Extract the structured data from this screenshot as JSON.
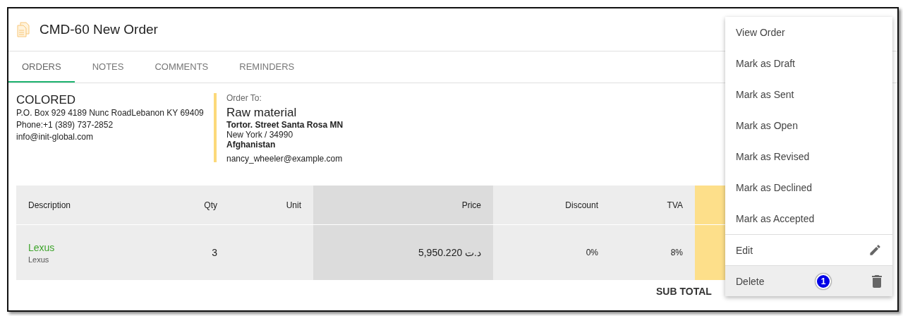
{
  "page": {
    "title": "CMD-60 New Order"
  },
  "tabs": [
    {
      "label": "ORDERS",
      "selected": true
    },
    {
      "label": "NOTES",
      "selected": false
    },
    {
      "label": "COMMENTS",
      "selected": false
    },
    {
      "label": "REMINDERS",
      "selected": false
    }
  ],
  "from": {
    "company": "COLORED",
    "address": "P.O. Box 929 4189 Nunc RoadLebanon KY 69409",
    "phone": "Phone:+1 (389) 737-2852",
    "email": "info@init-global.com"
  },
  "to": {
    "heading": "Order To:",
    "name": "Raw material",
    "street": "Tortor. Street Santa Rosa MN",
    "city": "New York / 34990",
    "country": "Afghanistan",
    "email": "nancy_wheeler@example.com"
  },
  "table": {
    "columns": [
      "Description",
      "Qty",
      "Unit",
      "Price",
      "Discount",
      "TVA"
    ],
    "rows": [
      {
        "name": "Lexus",
        "subtitle": "Lexus",
        "qty": "3",
        "unit": "",
        "price": "5,950.220 د.ت",
        "discount": "0%",
        "tva": "8%"
      }
    ]
  },
  "subtotal_label": "SUB TOTAL",
  "menu": {
    "items": [
      {
        "label": "View Order",
        "kind": "plain",
        "selected": false
      },
      {
        "label": "Mark as Draft",
        "kind": "plain",
        "selected": false
      },
      {
        "label": "Mark as Sent",
        "kind": "plain",
        "selected": false
      },
      {
        "label": "Mark as Open",
        "kind": "plain",
        "selected": false
      },
      {
        "label": "Mark as Revised",
        "kind": "plain",
        "selected": false
      },
      {
        "label": "Mark as Declined",
        "kind": "plain",
        "selected": false
      },
      {
        "label": "Mark as Accepted",
        "kind": "plain",
        "selected": false
      },
      {
        "label": "Edit",
        "kind": "edit",
        "selected": false
      },
      {
        "label": "Delete",
        "kind": "delete",
        "selected": true,
        "badge": "1"
      }
    ]
  }
}
